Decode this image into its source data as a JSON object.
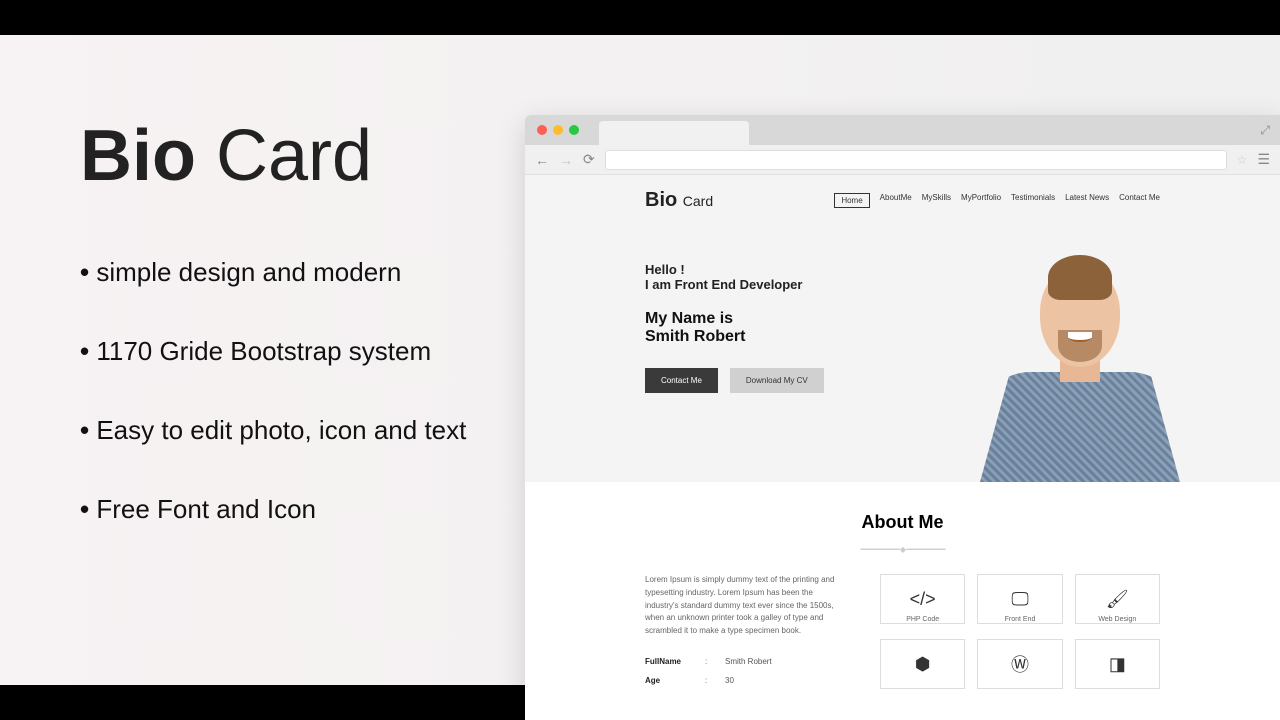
{
  "promo": {
    "logo_bold": "Bio",
    "logo_light": " Card",
    "features": [
      "simple design and modern",
      "1170 Gride Bootstrap system",
      "Easy to edit photo, icon and text",
      "Free Font and Icon"
    ]
  },
  "site": {
    "logo_bold": "Bio",
    "logo_light": "Card",
    "nav": [
      "Home",
      "AboutMe",
      "MySkills",
      "MyPortfolio",
      "Testimonials",
      "Latest News",
      "Contact Me"
    ],
    "hero": {
      "hello": "Hello !",
      "role": "I am Front End Developer",
      "nameis": "My Name is",
      "name": "Smith Robert",
      "btn_contact": "Contact Me",
      "btn_download": "Download My CV"
    },
    "about": {
      "title": "About Me",
      "text": "Lorem Ipsum is simply dummy text of the printing and typesetting industry. Lorem Ipsum has been the industry's standard dummy text ever since the 1500s, when an unknown printer took a galley of type and scrambled it to make a type specimen book.",
      "info": [
        {
          "label": "FullName",
          "value": "Smith Robert"
        },
        {
          "label": "Age",
          "value": "30"
        }
      ],
      "skills": [
        {
          "icon": "code-icon",
          "label": "PHP Code"
        },
        {
          "icon": "monitor-icon",
          "label": "Front End"
        },
        {
          "icon": "brush-icon",
          "label": "Web Design"
        },
        {
          "icon": "html5-icon",
          "label": ""
        },
        {
          "icon": "wordpress-icon",
          "label": ""
        },
        {
          "icon": "css3-icon",
          "label": ""
        }
      ]
    }
  }
}
